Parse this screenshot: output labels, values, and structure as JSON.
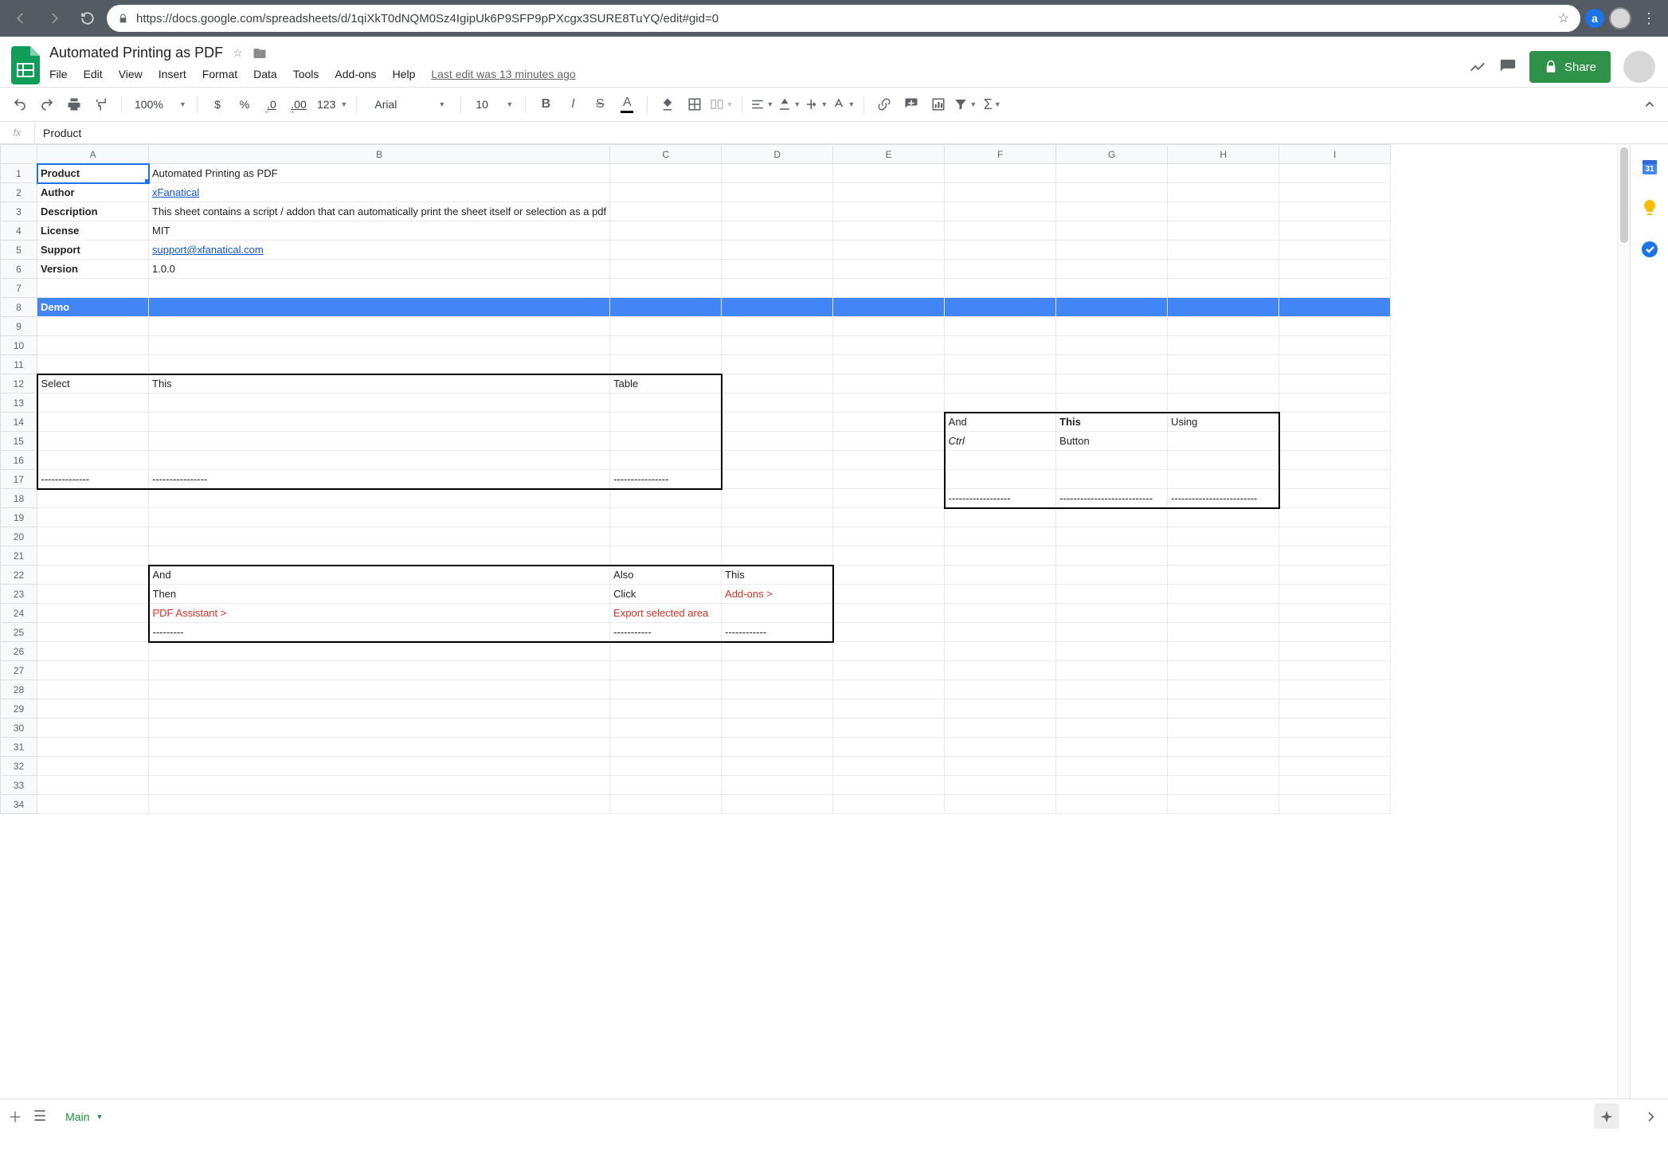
{
  "browser": {
    "url": "https://docs.google.com/spreadsheets/d/1qiXkT0dNQM0Sz4IgipUk6P9SFP9pPXcgx3SURE8TuYQ/edit#gid=0"
  },
  "doc": {
    "title": "Automated Printing as PDF",
    "last_edit": "Last edit was 13 minutes ago",
    "share_label": "Share"
  },
  "menus": {
    "file": "File",
    "edit": "Edit",
    "view": "View",
    "insert": "Insert",
    "format": "Format",
    "data": "Data",
    "tools": "Tools",
    "addons": "Add-ons",
    "help": "Help"
  },
  "toolbar": {
    "zoom": "100%",
    "currency": "$",
    "percent": "%",
    "dec_less": ".0",
    "dec_more": ".00",
    "more_fmt": "123",
    "font": "Arial",
    "font_size": "10",
    "bold": "B",
    "italic": "I",
    "strike": "S",
    "textcolor": "A"
  },
  "fx": {
    "value": "Product"
  },
  "columns": [
    "A",
    "B",
    "C",
    "D",
    "E",
    "F",
    "G",
    "H",
    "I"
  ],
  "rows": 34,
  "cells": {
    "A1": "Product",
    "B1": "Automated Printing as PDF",
    "A2": "Author",
    "B2": "xFanatical",
    "A3": "Description",
    "B3": "This sheet contains a script / addon that can automatically print the sheet itself or selection as a pdf",
    "A4": "License",
    "B4": "MIT",
    "A5": "Support",
    "B5": "support@xfanatical.com",
    "A6": "Version",
    "B6": "1.0.0",
    "A8": "Demo",
    "A12": "Select",
    "B12": "This",
    "C12": "Table",
    "A17": "--------------",
    "B17": "----------------",
    "C17": "----------------",
    "F14": "And",
    "G14": "This",
    "H14": "Using",
    "F15": "Ctrl",
    "G15": "Button",
    "F18": "------------------",
    "G18": "---------------------------",
    "H18": "-------------------------",
    "B22": "And",
    "C22": "Also",
    "D22": "This",
    "B23": "Then",
    "C23": "Click",
    "D23": "Add-ons >",
    "B24": "PDF Assistant >",
    "C24": "Export selected area",
    "B25": "---------",
    "C25": "-----------",
    "D25": "------------"
  },
  "tabs": {
    "main": "Main"
  }
}
